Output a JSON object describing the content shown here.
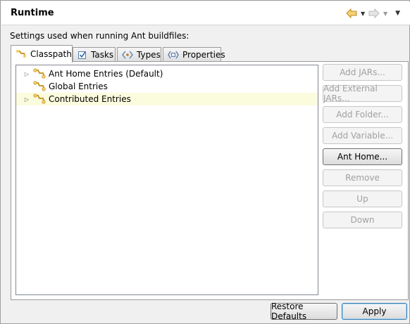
{
  "header": {
    "title": "Runtime",
    "back_icon": "back-arrow-icon",
    "forward_icon": "forward-arrow-icon",
    "accent_color": "#e8b94a"
  },
  "settings_label": "Settings used when running Ant buildfiles:",
  "tabs": [
    {
      "label": "Classpath",
      "icon": "classpath-icon",
      "active": true
    },
    {
      "label": "Tasks",
      "icon": "tasks-icon",
      "active": false
    },
    {
      "label": "Types",
      "icon": "types-icon",
      "active": false
    },
    {
      "label": "Properties",
      "icon": "properties-icon",
      "active": false
    }
  ],
  "tree": {
    "items": [
      {
        "label": "Ant Home Entries (Default)",
        "expandable": true,
        "highlighted": false
      },
      {
        "label": "Global Entries",
        "expandable": false,
        "highlighted": false
      },
      {
        "label": "Contributed Entries",
        "expandable": true,
        "highlighted": true
      }
    ]
  },
  "buttons": {
    "add_jars": "Add JARs...",
    "add_external_jars": "Add External JARs...",
    "add_folder": "Add Folder...",
    "add_variable": "Add Variable...",
    "ant_home": "Ant Home...",
    "remove": "Remove",
    "up": "Up",
    "down": "Down"
  },
  "footer": {
    "restore_defaults": "Restore Defaults",
    "apply": "Apply"
  }
}
